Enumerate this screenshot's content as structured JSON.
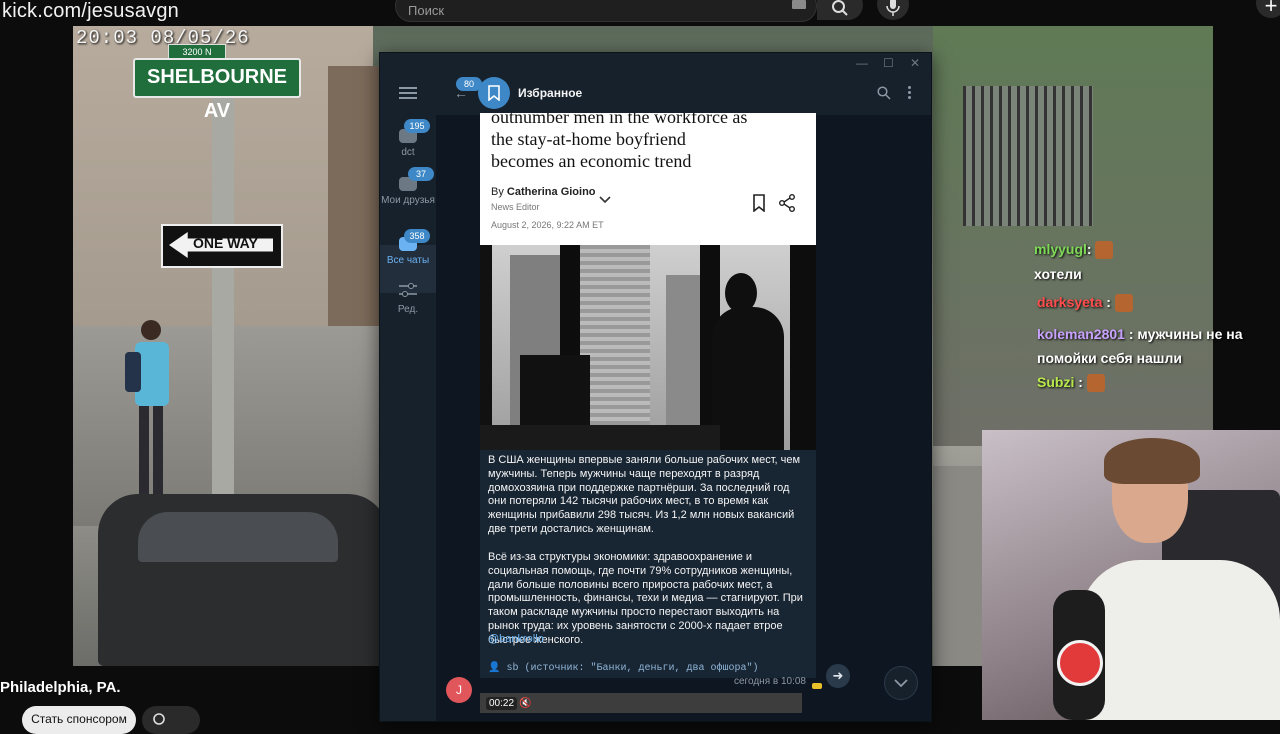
{
  "stream": {
    "url": "kick.com/jesusavgn",
    "search_placeholder": "Поиск",
    "title": "Philadelphia, PA.",
    "follow_label": "Стать спонсором"
  },
  "camera": {
    "timestamp": "20:03  08/05/26",
    "street_sign": "SHELBOURNE AV",
    "street_number": "3200 N",
    "oneway_sign": "ONE WAY"
  },
  "chat": [
    {
      "user": "mlyyugl",
      "sep": ":",
      "text": "хотели",
      "color": "#7ed957"
    },
    {
      "user": "darksyeta",
      "sep": ":",
      "text": "",
      "color": "#ff4d4d",
      "emote": true
    },
    {
      "user": "koleman2801",
      "sep": ":",
      "text": "мужчины не на помойки себя нашли",
      "color": "#c9a2ff"
    },
    {
      "user": "Subzi",
      "sep": ":",
      "text": "",
      "color": "#b8e94a",
      "emote": true
    }
  ],
  "telegram": {
    "back_badge": "80",
    "chat_title": "Избранное",
    "sidebar": [
      {
        "label": "dct",
        "badge": "195"
      },
      {
        "label": "Мои друзья",
        "badge": "37"
      },
      {
        "label": "Все чаты",
        "badge": "358"
      },
      {
        "label": "Ред.",
        "badge": ""
      }
    ],
    "article": {
      "title_lines": [
        "outnumber men in the workforce as",
        "the stay-at-home boyfriend",
        "becomes an economic trend"
      ],
      "by": "By",
      "author": "Catherina Gioino",
      "role": "News Editor",
      "date": "August 2, 2026, 9:22 AM ET"
    },
    "message": {
      "p1": "В США женщины впервые заняли больше рабочих мест, чем мужчины. Теперь мужчины чаще переходят в разряд домохозяина при поддержке партнёрши. За последний год они потеряли 142 тысячи рабочих мест, в то время как женщины прибавили 298 тысяч. Из 1,2 млн новых вакансий две трети достались женщинам.",
      "p2": "Всё из-за структуры экономики: здравоохранение и социальная помощь, где почти 79% сотрудников женщины, дали больше половины всего прироста рабочих мест, а промышленность, финансы, техи и медиа — стагнируют. При таком раскладе мужчины просто перестают выходить на рынок труда: их уровень занятости с 2000-х падает втрое быстрее женского.",
      "link": "@bankrollo",
      "source": "👤 sb (источник: \"Банки, деньги, два офшора\")",
      "time": "сегодня в 10:08",
      "avatar_letter": "J",
      "video_time": "00:22"
    }
  },
  "colors": {
    "tg_bg": "#0e1621",
    "tg_panel": "#17212b",
    "tg_accent": "#3e88c7",
    "link": "#6ab2f2"
  }
}
